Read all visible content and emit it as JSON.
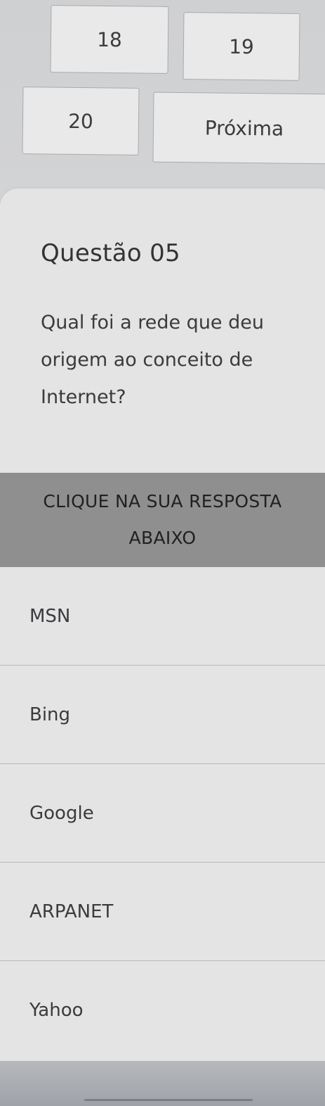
{
  "pagination": {
    "page_18": "18",
    "page_19": "19",
    "page_20": "20",
    "next_label": "Próxima"
  },
  "question": {
    "title": "Questão 05",
    "text": "Qual foi a rede que deu origem ao conceito de Internet?"
  },
  "instruction": {
    "text": "CLIQUE NA SUA RESPOSTA ABAIXO"
  },
  "answers": [
    {
      "label": "MSN"
    },
    {
      "label": "Bing"
    },
    {
      "label": "Google"
    },
    {
      "label": "ARPANET"
    },
    {
      "label": "Yahoo"
    }
  ]
}
